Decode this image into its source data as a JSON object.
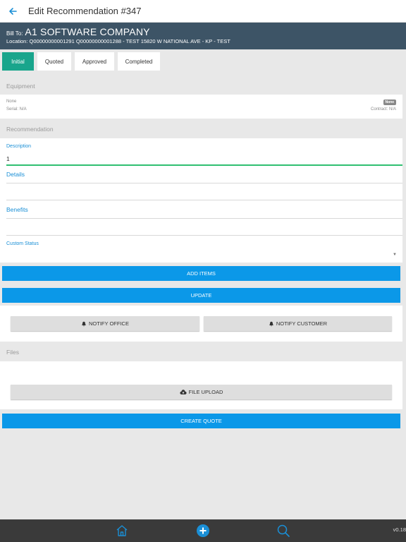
{
  "header": {
    "title": "Edit Recommendation #347",
    "back_icon": "arrow-left-icon"
  },
  "bill_to": {
    "label": "Bill To:",
    "company": "A1 SOFTWARE COMPANY",
    "location": "Location: Q00000000001291 Q00000000001288 - TEST 15820 W NATIONAL AVE - KP - TEST"
  },
  "tabs": [
    {
      "label": "Initial",
      "active": true
    },
    {
      "label": "Quoted",
      "active": false
    },
    {
      "label": "Approved",
      "active": false
    },
    {
      "label": "Completed",
      "active": false
    }
  ],
  "equipment": {
    "header": "Equipment",
    "name": "None",
    "badge": "None",
    "serial": "Serial: N/A",
    "contract": "Contract: N/A"
  },
  "recommendation": {
    "header": "Recommendation",
    "description_label": "Description",
    "description_value": "1",
    "details_label": "Details",
    "benefits_label": "Benefits",
    "custom_status_label": "Custom Status"
  },
  "buttons": {
    "add_items": "ADD ITEMS",
    "update": "UPDATE",
    "notify_office": "NOTIFY OFFICE",
    "notify_customer": "NOTIFY CUSTOMER",
    "file_upload": "FILE UPLOAD",
    "create_quote": "CREATE QUOTE"
  },
  "files": {
    "header": "Files"
  },
  "bottom_nav": {
    "items": [
      "home-icon",
      "add-circle-icon",
      "search-icon"
    ],
    "version": "v0.18"
  },
  "colors": {
    "accent_blue": "#0b98e8",
    "active_tab": "#19a58c",
    "billto_bg": "#3d5466",
    "bottom_bar": "#3a3a3a"
  }
}
